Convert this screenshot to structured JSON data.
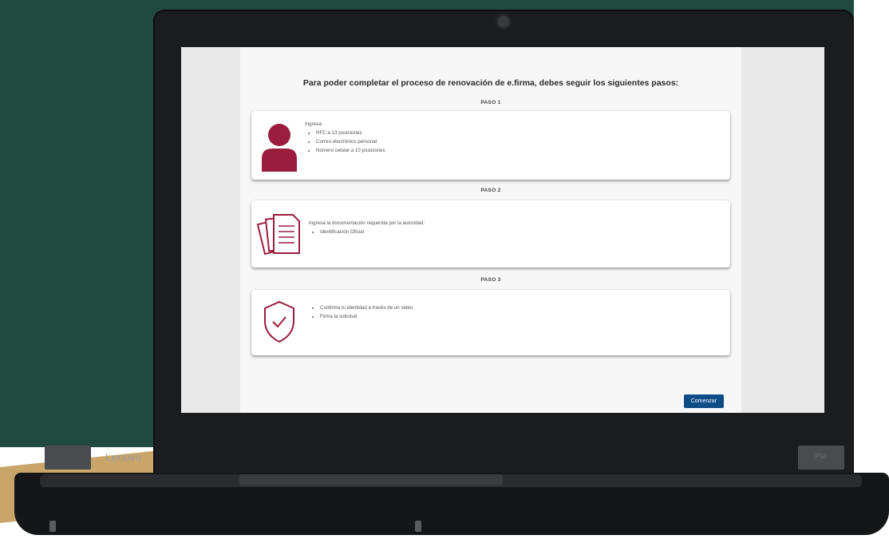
{
  "laptop": {
    "brand": "Lenovo",
    "model": "P50"
  },
  "page": {
    "title": "Para poder completar el proceso de renovación de e.firma, debes seguir los siguientes pasos:",
    "steps": [
      {
        "label": "PASO 1",
        "intro": "Ingresa:",
        "items": [
          "RFC a 13 posiciones",
          "Correo electrónico personal",
          "Número celular a 10 posiciones"
        ],
        "icon": "user-icon"
      },
      {
        "label": "PASO 2",
        "intro": "Ingresa la documentación requerida por la autoridad:",
        "items": [
          "Identificación Oficial"
        ],
        "icon": "documents-icon"
      },
      {
        "label": "PASO 3",
        "intro": "",
        "items": [
          "Confirma tu identidad a través de un video",
          "Firma la solicitud"
        ],
        "icon": "shield-check-icon"
      }
    ],
    "start_button": "Comenzar"
  },
  "colors": {
    "accent": "#9b1d3d",
    "button": "#0d4c85",
    "background": "#214a3f"
  }
}
